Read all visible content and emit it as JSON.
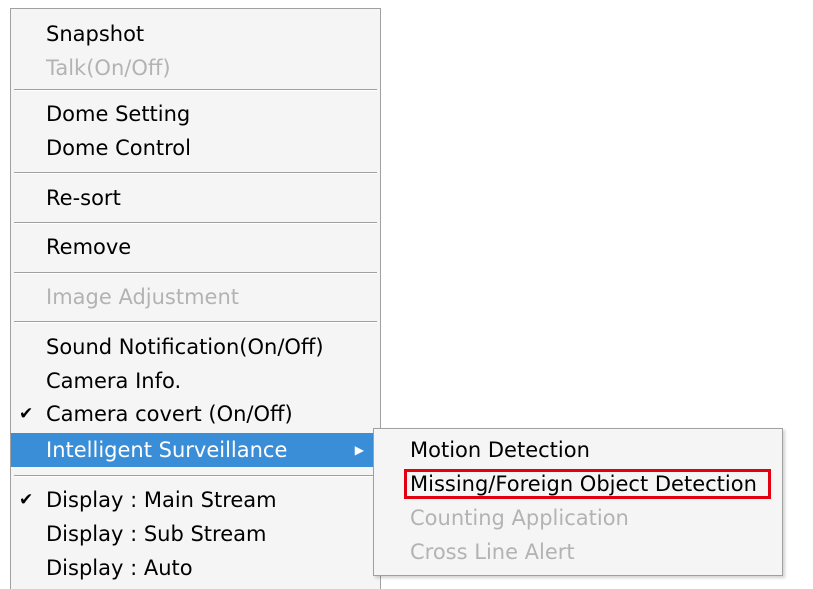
{
  "main_menu": {
    "items": [
      {
        "label": "Snapshot",
        "disabled": false,
        "checked": false
      },
      {
        "label": "Talk(On/Off)",
        "disabled": true,
        "checked": false
      },
      {
        "label": "Dome Setting",
        "disabled": false,
        "checked": false
      },
      {
        "label": "Dome Control",
        "disabled": false,
        "checked": false
      },
      {
        "label": "Re-sort",
        "disabled": false,
        "checked": false
      },
      {
        "label": "Remove",
        "disabled": false,
        "checked": false
      },
      {
        "label": "Image Adjustment",
        "disabled": true,
        "checked": false
      },
      {
        "label": "Sound Notification(On/Off)",
        "disabled": false,
        "checked": false
      },
      {
        "label": "Camera Info.",
        "disabled": false,
        "checked": false
      },
      {
        "label": "Camera covert (On/Off)",
        "disabled": false,
        "checked": true
      },
      {
        "label": "Intelligent Surveillance",
        "disabled": false,
        "checked": false,
        "highlighted": true,
        "submenu": true
      },
      {
        "label": "Display : Main Stream",
        "disabled": false,
        "checked": true
      },
      {
        "label": "Display : Sub Stream",
        "disabled": false,
        "checked": false
      },
      {
        "label": "Display : Auto",
        "disabled": false,
        "checked": false
      }
    ]
  },
  "sub_menu": {
    "items": [
      {
        "label": "Motion Detection",
        "disabled": false
      },
      {
        "label": "Missing/Foreign Object Detection",
        "disabled": false,
        "annotated": true
      },
      {
        "label": "Counting Application",
        "disabled": true
      },
      {
        "label": "Cross Line Alert",
        "disabled": true
      }
    ]
  },
  "icons": {
    "check": "checkmark-icon",
    "submenu_arrow": "triangle-right-icon"
  },
  "colors": {
    "highlight": "#3a8ed8",
    "disabled_text": "#b3b3b3",
    "annotation_border": "#e3000f"
  }
}
